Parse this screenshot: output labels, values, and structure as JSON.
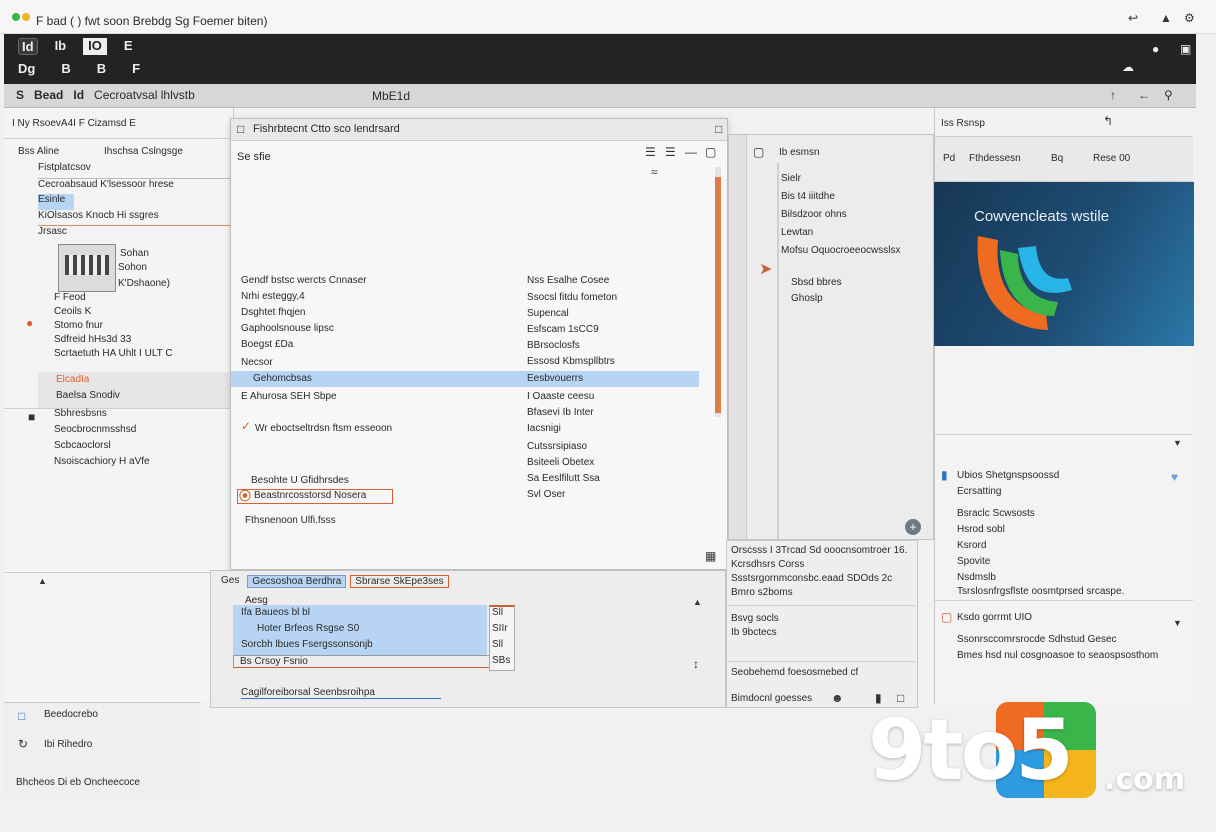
{
  "title_bar": {
    "title": "F bad  (  ) fwt soon Brebdg Sg Foemer biten)",
    "right_icons": [
      "back-icon",
      "up-icon",
      "settings-icon"
    ]
  },
  "dark_bar": {
    "row1": [
      "Id",
      "Ib",
      "IO",
      "E"
    ],
    "row2": [
      "Dg",
      "B",
      "B",
      "F"
    ]
  },
  "toolbar": {
    "items": [
      "S",
      "Bead",
      "Id",
      "Cecroatvsal lhlvstb"
    ],
    "center_label": "MbE1d"
  },
  "left_panel": {
    "header": "I Ny RsoevA4I F Cizamsd  E",
    "cols": [
      "Bss Aline",
      "Ihschsa  Cslngsge"
    ],
    "items": [
      "Fistplatcsov",
      "Cecroabsaud K'lsessoor hrese",
      "Esinle",
      "KiOlsasos Knocb Hi  ssgres",
      "Jrsasc",
      "Sohan",
      "Sohon",
      "K'Dshaone)",
      "F Feod",
      "Ceoils K",
      "Stomo fnur",
      "Sdfreid hHs3d 33",
      "Scrtaetuth HA Uhlt I ULT  C",
      "ElcadIa",
      "Baelsa  Snodiv",
      "Sbhresbsns",
      "Seocbrocnmsshsd",
      "Scbcaoclorsl",
      "Nsoiscachiory H aVfe"
    ],
    "bottom_items": [
      "Beedocrebo",
      "Ibi Rihedro",
      "Bhcheos Di eb Oncheecoce"
    ]
  },
  "dialog": {
    "title": "Fishrbtecnt Ctto sco lendrsard",
    "subtitle": "Se sfie",
    "left_col": [
      "Gendf bstsc wercts  Cnnaser",
      "Nrhi esteggy,4",
      "Dsghtet fhqjen",
      "Gaphoolsnouse lipsc",
      "Boegst  £Da",
      "Necsor",
      "Gehomcbsas",
      "E Ahurosa SEH Sbpe",
      "Wr eboctseltrdsn ftsm esseoon",
      "Besohte U Gfidhrsdes",
      "Beastnrcosstorsd Nosera",
      "Fthsnenoon Ulfi.fsss"
    ],
    "right_col": [
      "Nss Esalhe Cosee",
      "Ssocsl fitdu fometon",
      "Supencal",
      "Esfscam 1sCC9",
      "BBrsoclosfs",
      "Essosd Kbmspllbtrs",
      "Eesbvouerrs",
      "I Oaaste ceesu",
      "Bfasevi Ib Inter",
      "Iacsnigi",
      "Cutssrsipiaso",
      "Bsiteeli Obetex",
      "Sa Eeslfilutt Ssa",
      "Svl Oser"
    ],
    "bottom_tabs": [
      "Ges",
      "Gecsoshoa Berdhra",
      "Sbrarse SkEpe3ses"
    ],
    "bottom_list_header": "Aesg",
    "bottom_list": [
      "Ifa Baueos bl bl",
      "Hoter Brfeos Rsgse S0",
      "Sorcbh lbues Fsergssonsonjb",
      "Bs Crsoy  Fsnio"
    ],
    "bottom_side": [
      "Sll",
      "SIIr",
      "Sll",
      "SBs"
    ],
    "bottom_footer": "Cagilforeiborsal Seenbsroihpa"
  },
  "inspector": {
    "title": "Ib esmsn",
    "items": [
      "Sielr",
      "Bis t4 iiitdhe",
      "Bilsdzoor ohns",
      "Lewtan",
      "Mofsu  Oquocroeeocwsslsx",
      "Sbsd bbres",
      "Ghoslp"
    ],
    "lower_lines": [
      "Orscsss    I 3Trcad  Sd ooocnsomtroer 16.",
      "Kcrsdhsrs Corss",
      "Ssstsrgornmconsbc.eaad   SDOds 2c",
      "Bmro s2boms",
      "Bsvg socls",
      "Ib 9bctecs",
      "Seobehemd foesosmebed  cf",
      "Bimdocnl goesses"
    ]
  },
  "right_panel": {
    "header": "Iss Rsnsp",
    "toolbar": [
      "Pd",
      "Fthdessesn",
      "Bq",
      "Rese 00"
    ],
    "hero_title": "Cowvencleats wstile",
    "info_title": "Ubios Shetgnspsoossd",
    "info_sub": "Ecrsatting",
    "info_items": [
      "Bsraclc Scwsosts",
      "Hsrod sobl",
      "Ksrord",
      "Spovite",
      "Nsdmslb",
      "Tsrslosnfrgsflste oosmtprsed srcaspe."
    ],
    "section2_title": "Ksdo gorrmt UIO",
    "section2_lines": [
      "Ssonrsccomrsrocde Sdhstud Gesec",
      "Bmes hsd  nul cosgnoasoe to seaospsosthom"
    ]
  },
  "watermark": {
    "text": "9to5",
    "suffix": ".com",
    "tile_colors": [
      "#f06b22",
      "#f4b41c",
      "#3ab54a",
      "#2d9be0"
    ]
  },
  "colors": {
    "accent": "#d9602c",
    "selection": "#b7d5f3",
    "hero_bg": "#1e4d74"
  }
}
